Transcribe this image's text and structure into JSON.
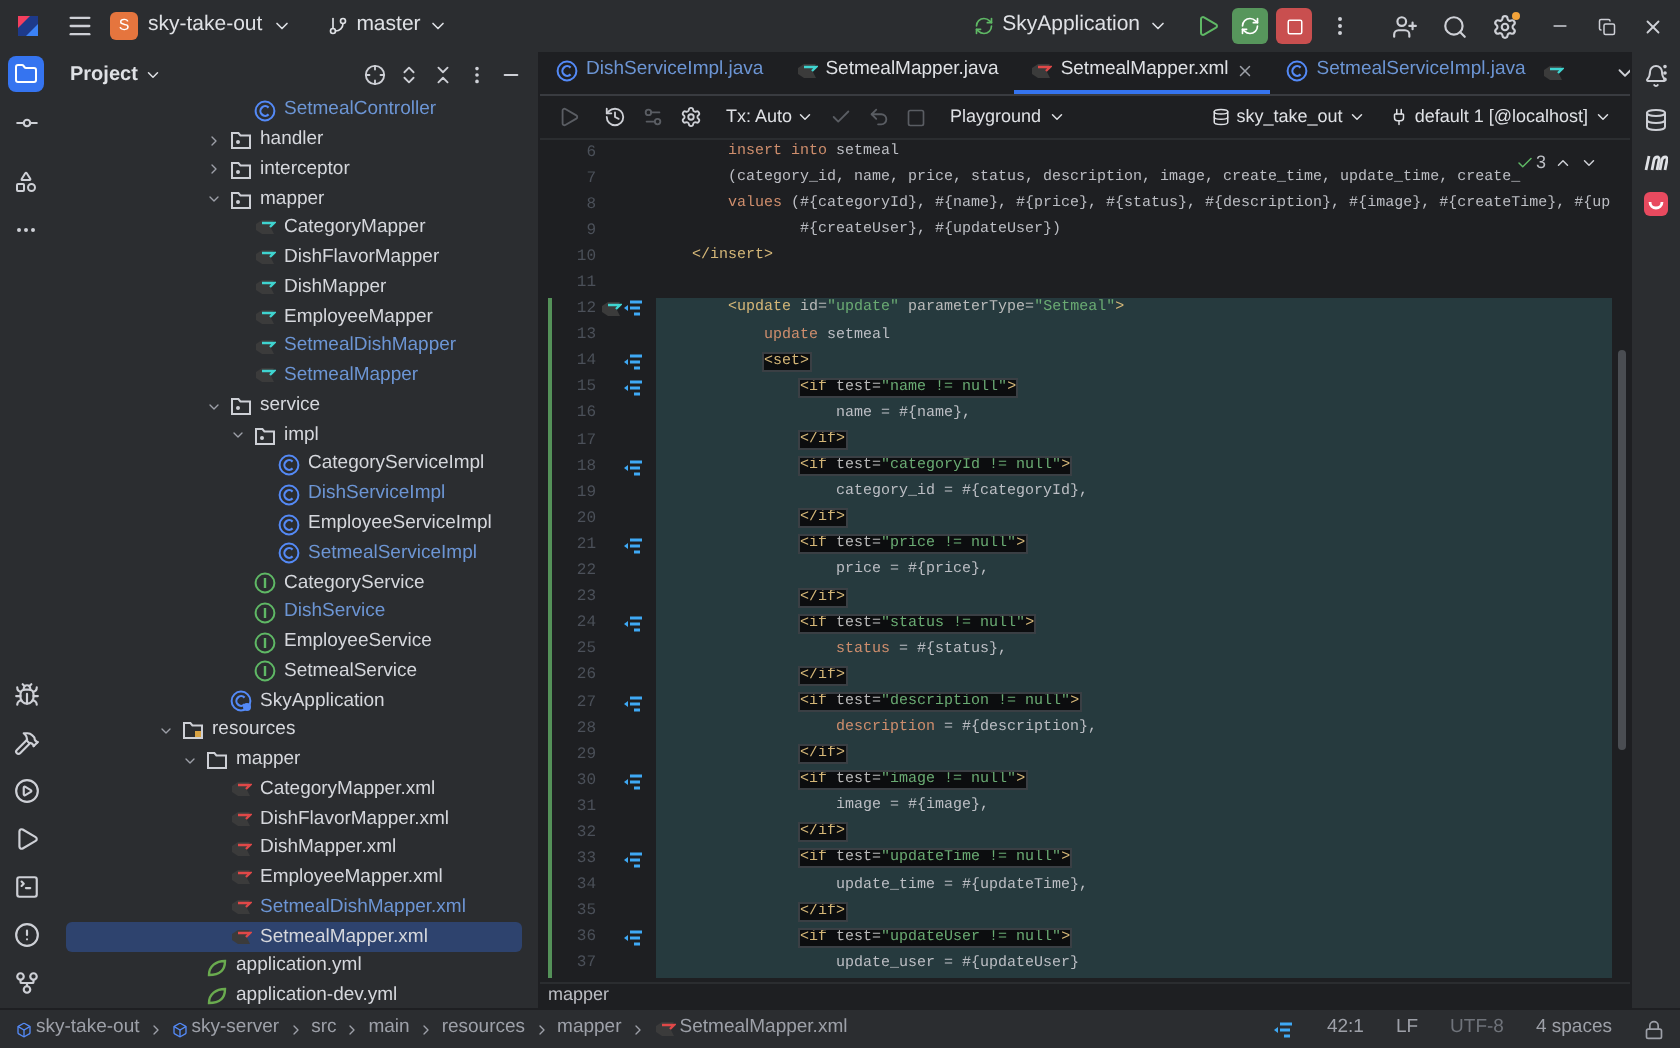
{
  "title_bar": {
    "project_badge": "S",
    "project": "sky-take-out",
    "branch": "master",
    "run_config": "SkyApplication"
  },
  "project_panel": {
    "title": "Project",
    "tree": [
      {
        "children": [
          {
            "children": [
              {
                "children": [
                  {
                    "name": "SetmealController",
                    "kind": "class",
                    "modified": true,
                    "selected": false
                  }
                ]
              },
              {
                "name": "handler",
                "kind": "package",
                "expanded": false,
                "modified": false,
                "selected": false
              },
              {
                "name": "interceptor",
                "kind": "package",
                "expanded": false,
                "modified": false,
                "selected": false
              },
              {
                "name": "mapper",
                "kind": "package",
                "expanded": true,
                "modified": false,
                "selected": false,
                "children": [
                  {
                    "name": "CategoryMapper",
                    "kind": "mapper",
                    "modified": false,
                    "selected": false
                  },
                  {
                    "name": "DishFlavorMapper",
                    "kind": "mapper",
                    "modified": false,
                    "selected": false
                  },
                  {
                    "name": "DishMapper",
                    "kind": "mapper",
                    "modified": false,
                    "selected": false
                  },
                  {
                    "name": "EmployeeMapper",
                    "kind": "mapper",
                    "modified": false,
                    "selected": false
                  },
                  {
                    "name": "SetmealDishMapper",
                    "kind": "mapper",
                    "modified": true,
                    "selected": false
                  },
                  {
                    "name": "SetmealMapper",
                    "kind": "mapper",
                    "modified": true,
                    "selected": false
                  }
                ]
              },
              {
                "name": "service",
                "kind": "package",
                "expanded": true,
                "modified": false,
                "selected": false,
                "children": [
                  {
                    "name": "impl",
                    "kind": "package",
                    "expanded": true,
                    "modified": false,
                    "selected": false,
                    "children": [
                      {
                        "name": "CategoryServiceImpl",
                        "kind": "class",
                        "modified": false,
                        "selected": false
                      },
                      {
                        "name": "DishServiceImpl",
                        "kind": "class",
                        "modified": true,
                        "selected": false
                      },
                      {
                        "name": "EmployeeServiceImpl",
                        "kind": "class",
                        "modified": false,
                        "selected": false
                      },
                      {
                        "name": "SetmealServiceImpl",
                        "kind": "class",
                        "modified": true,
                        "selected": false
                      }
                    ]
                  },
                  {
                    "name": "CategoryService",
                    "kind": "interface",
                    "modified": false,
                    "selected": false
                  },
                  {
                    "name": "DishService",
                    "kind": "interface",
                    "modified": true,
                    "selected": false
                  },
                  {
                    "name": "EmployeeService",
                    "kind": "interface",
                    "modified": false,
                    "selected": false
                  },
                  {
                    "name": "SetmealService",
                    "kind": "interface",
                    "modified": false,
                    "selected": false
                  }
                ]
              },
              {
                "name": "SkyApplication",
                "kind": "app",
                "modified": false,
                "selected": false
              }
            ]
          }
        ]
      },
      {
        "name": "resources",
        "kind": "resources",
        "expanded": true,
        "modified": false,
        "selected": false,
        "children": [
          {
            "name": "mapper",
            "kind": "folder",
            "expanded": true,
            "modified": false,
            "selected": false,
            "children": [
              {
                "name": "CategoryMapper.xml",
                "kind": "xml",
                "modified": false,
                "selected": false
              },
              {
                "name": "DishFlavorMapper.xml",
                "kind": "xml",
                "modified": false,
                "selected": false
              },
              {
                "name": "DishMapper.xml",
                "kind": "xml",
                "modified": false,
                "selected": false
              },
              {
                "name": "EmployeeMapper.xml",
                "kind": "xml",
                "modified": false,
                "selected": false
              },
              {
                "name": "SetmealDishMapper.xml",
                "kind": "xml",
                "modified": true,
                "selected": false
              },
              {
                "name": "SetmealMapper.xml",
                "kind": "xml",
                "modified": false,
                "selected": true
              }
            ]
          },
          {
            "name": "application.yml",
            "kind": "yml",
            "modified": false,
            "selected": false
          },
          {
            "name": "application-dev.yml",
            "kind": "yml",
            "modified": false,
            "selected": false
          }
        ]
      }
    ]
  },
  "tabs": [
    {
      "label": "DishServiceImpl.java",
      "kind": "class",
      "modified": true,
      "selected": false
    },
    {
      "label": "SetmealMapper.java",
      "kind": "mapper",
      "modified": false,
      "selected": false
    },
    {
      "label": "SetmealMapper.xml",
      "kind": "xml",
      "modified": false,
      "selected": true
    },
    {
      "label": "SetmealServiceImpl.java",
      "kind": "class",
      "modified": true,
      "selected": false
    }
  ],
  "editor_toolbar": {
    "transaction": "Tx: Auto",
    "mode": "Playground",
    "schema": "sky_take_out",
    "session": "default 1 [@localhost]"
  },
  "inspections": {
    "count": "3"
  },
  "code_lines": [
    {
      "number": "6",
      "changed": false,
      "highlighted": false,
      "boxed": false,
      "navigable": false,
      "mapper_link": false,
      "segments": [
        {
          "kind": "k",
          "text": "        insert into"
        },
        {
          "kind": "p",
          "text": " setmeal"
        }
      ]
    },
    {
      "number": "7",
      "changed": false,
      "highlighted": false,
      "boxed": false,
      "navigable": false,
      "mapper_link": false,
      "segments": [
        {
          "kind": "p",
          "text": "        (category_id, name, price, status, description, image, create_time, update_time, create_"
        }
      ]
    },
    {
      "number": "8",
      "changed": false,
      "highlighted": false,
      "boxed": false,
      "navigable": false,
      "mapper_link": false,
      "segments": [
        {
          "kind": "k",
          "text": "        values"
        },
        {
          "kind": "p",
          "text": " (#{categoryId}, #{name}, #{price}, #{status}, #{description}, #{image}, #{createTime}, #{up"
        }
      ]
    },
    {
      "number": "9",
      "changed": false,
      "highlighted": false,
      "boxed": false,
      "navigable": false,
      "mapper_link": false,
      "segments": [
        {
          "kind": "p",
          "text": "                #{createUser}, #{updateUser})"
        }
      ]
    },
    {
      "number": "10",
      "changed": false,
      "highlighted": false,
      "boxed": false,
      "navigable": false,
      "mapper_link": false,
      "segments": [
        {
          "kind": "t",
          "text": "    </insert>"
        }
      ]
    },
    {
      "number": "11",
      "changed": false,
      "highlighted": false,
      "navigable": false,
      "mapper_link": false
    },
    {
      "number": "12",
      "changed": true,
      "highlighted": true,
      "boxed": false,
      "navigable": true,
      "mapper_link": true,
      "segments": [
        {
          "kind": "t",
          "text": "        <update"
        },
        {
          "kind": "a",
          "text": " id="
        },
        {
          "kind": "s",
          "text": "\"update\""
        },
        {
          "kind": "a",
          "text": " parameterType="
        },
        {
          "kind": "s",
          "text": "\"Setmeal\""
        },
        {
          "kind": "t",
          "text": ">"
        }
      ]
    },
    {
      "number": "13",
      "changed": true,
      "highlighted": true,
      "boxed": false,
      "navigable": false,
      "mapper_link": false,
      "segments": [
        {
          "kind": "k",
          "text": "            update"
        },
        {
          "kind": "p",
          "text": " setmeal"
        }
      ]
    },
    {
      "number": "14",
      "changed": true,
      "highlighted": true,
      "boxed": true,
      "navigable": true,
      "mapper_link": false,
      "segments": [
        {
          "kind": "t",
          "text": "            <set>"
        }
      ]
    },
    {
      "number": "15",
      "changed": true,
      "highlighted": true,
      "boxed": true,
      "navigable": true,
      "mapper_link": false,
      "segments": [
        {
          "kind": "t",
          "text": "                <if"
        },
        {
          "kind": "a",
          "text": " test="
        },
        {
          "kind": "s",
          "text": "\"name != null\""
        },
        {
          "kind": "t",
          "text": ">"
        }
      ]
    },
    {
      "number": "16",
      "changed": true,
      "highlighted": true,
      "boxed": false,
      "navigable": false,
      "mapper_link": false,
      "segments": [
        {
          "kind": "p",
          "text": "                    name = #{name},"
        }
      ]
    },
    {
      "number": "17",
      "changed": true,
      "highlighted": true,
      "boxed": true,
      "navigable": false,
      "mapper_link": false,
      "segments": [
        {
          "kind": "t",
          "text": "                </if>"
        }
      ]
    },
    {
      "number": "18",
      "changed": true,
      "highlighted": true,
      "boxed": true,
      "navigable": true,
      "mapper_link": false,
      "segments": [
        {
          "kind": "t",
          "text": "                <if"
        },
        {
          "kind": "a",
          "text": " test="
        },
        {
          "kind": "s",
          "text": "\"categoryId != null\""
        },
        {
          "kind": "t",
          "text": ">"
        }
      ]
    },
    {
      "number": "19",
      "changed": true,
      "highlighted": true,
      "boxed": false,
      "navigable": false,
      "mapper_link": false,
      "segments": [
        {
          "kind": "p",
          "text": "                    category_id = #{categoryId},"
        }
      ]
    },
    {
      "number": "20",
      "changed": true,
      "highlighted": true,
      "boxed": true,
      "navigable": false,
      "mapper_link": false,
      "segments": [
        {
          "kind": "t",
          "text": "                </if>"
        }
      ]
    },
    {
      "number": "21",
      "changed": true,
      "highlighted": true,
      "boxed": true,
      "navigable": true,
      "mapper_link": false,
      "segments": [
        {
          "kind": "t",
          "text": "                <if"
        },
        {
          "kind": "a",
          "text": " test="
        },
        {
          "kind": "s",
          "text": "\"price != null\""
        },
        {
          "kind": "t",
          "text": ">"
        }
      ]
    },
    {
      "number": "22",
      "changed": true,
      "highlighted": true,
      "boxed": false,
      "navigable": false,
      "mapper_link": false,
      "segments": [
        {
          "kind": "p",
          "text": "                    price = #{price},"
        }
      ]
    },
    {
      "number": "23",
      "changed": true,
      "highlighted": true,
      "boxed": true,
      "navigable": false,
      "mapper_link": false,
      "segments": [
        {
          "kind": "t",
          "text": "                </if>"
        }
      ]
    },
    {
      "number": "24",
      "changed": true,
      "highlighted": true,
      "boxed": true,
      "navigable": true,
      "mapper_link": false,
      "segments": [
        {
          "kind": "t",
          "text": "                <if"
        },
        {
          "kind": "a",
          "text": " test="
        },
        {
          "kind": "s",
          "text": "\"status != null\""
        },
        {
          "kind": "t",
          "text": ">"
        }
      ]
    },
    {
      "number": "25",
      "changed": true,
      "highlighted": true,
      "boxed": false,
      "navigable": false,
      "mapper_link": false,
      "segments": [
        {
          "kind": "k",
          "text": "                    status"
        },
        {
          "kind": "p",
          "text": " = #{status},"
        }
      ]
    },
    {
      "number": "26",
      "changed": true,
      "highlighted": true,
      "boxed": true,
      "navigable": false,
      "mapper_link": false,
      "segments": [
        {
          "kind": "t",
          "text": "                </if>"
        }
      ]
    },
    {
      "number": "27",
      "changed": true,
      "highlighted": true,
      "boxed": true,
      "navigable": true,
      "mapper_link": false,
      "segments": [
        {
          "kind": "t",
          "text": "                <if"
        },
        {
          "kind": "a",
          "text": " test="
        },
        {
          "kind": "s",
          "text": "\"description != null\""
        },
        {
          "kind": "t",
          "text": ">"
        }
      ]
    },
    {
      "number": "28",
      "changed": true,
      "highlighted": true,
      "boxed": false,
      "navigable": false,
      "mapper_link": false,
      "segments": [
        {
          "kind": "k",
          "text": "                    description"
        },
        {
          "kind": "p",
          "text": " = #{description},"
        }
      ]
    },
    {
      "number": "29",
      "changed": true,
      "highlighted": true,
      "boxed": true,
      "navigable": false,
      "mapper_link": false,
      "segments": [
        {
          "kind": "t",
          "text": "                </if>"
        }
      ]
    },
    {
      "number": "30",
      "changed": true,
      "highlighted": true,
      "boxed": true,
      "navigable": true,
      "mapper_link": false,
      "segments": [
        {
          "kind": "t",
          "text": "                <if"
        },
        {
          "kind": "a",
          "text": " test="
        },
        {
          "kind": "s",
          "text": "\"image != null\""
        },
        {
          "kind": "t",
          "text": ">"
        }
      ]
    },
    {
      "number": "31",
      "changed": true,
      "highlighted": true,
      "boxed": false,
      "navigable": false,
      "mapper_link": false,
      "segments": [
        {
          "kind": "p",
          "text": "                    image = #{image},"
        }
      ]
    },
    {
      "number": "32",
      "changed": true,
      "highlighted": true,
      "boxed": true,
      "navigable": false,
      "mapper_link": false,
      "segments": [
        {
          "kind": "t",
          "text": "                </if>"
        }
      ]
    },
    {
      "number": "33",
      "changed": true,
      "highlighted": true,
      "boxed": true,
      "navigable": true,
      "mapper_link": false,
      "segments": [
        {
          "kind": "t",
          "text": "                <if"
        },
        {
          "kind": "a",
          "text": " test="
        },
        {
          "kind": "s",
          "text": "\"updateTime != null\""
        },
        {
          "kind": "t",
          "text": ">"
        }
      ]
    },
    {
      "number": "34",
      "changed": true,
      "highlighted": true,
      "boxed": false,
      "navigable": false,
      "mapper_link": false,
      "segments": [
        {
          "kind": "p",
          "text": "                    update_time = #{updateTime},"
        }
      ]
    },
    {
      "number": "35",
      "changed": true,
      "highlighted": true,
      "boxed": true,
      "navigable": false,
      "mapper_link": false,
      "segments": [
        {
          "kind": "t",
          "text": "                </if>"
        }
      ]
    },
    {
      "number": "36",
      "changed": true,
      "highlighted": true,
      "boxed": true,
      "navigable": true,
      "mapper_link": false,
      "segments": [
        {
          "kind": "t",
          "text": "                <if"
        },
        {
          "kind": "a",
          "text": " test="
        },
        {
          "kind": "s",
          "text": "\"updateUser != null\""
        },
        {
          "kind": "t",
          "text": ">"
        }
      ]
    },
    {
      "number": "37",
      "changed": true,
      "highlighted": true,
      "boxed": false,
      "navigable": false,
      "mapper_link": false,
      "segments": [
        {
          "kind": "p",
          "text": "                    update_user = #{updateUser}"
        }
      ]
    }
  ],
  "editor_breadcrumb": "mapper",
  "status_bar": {
    "path": [
      {
        "label": "sky-take-out",
        "kind": "module"
      },
      {
        "label": "sky-server",
        "kind": "module"
      },
      {
        "label": "src",
        "kind": "dir"
      },
      {
        "label": "main",
        "kind": "dir"
      },
      {
        "label": "resources",
        "kind": "dir"
      },
      {
        "label": "mapper",
        "kind": "dir"
      },
      {
        "label": "SetmealMapper.xml",
        "kind": "xml"
      }
    ],
    "position": "42:1",
    "line_ending": "LF",
    "encoding": "UTF-8",
    "indent": "4 spaces"
  }
}
